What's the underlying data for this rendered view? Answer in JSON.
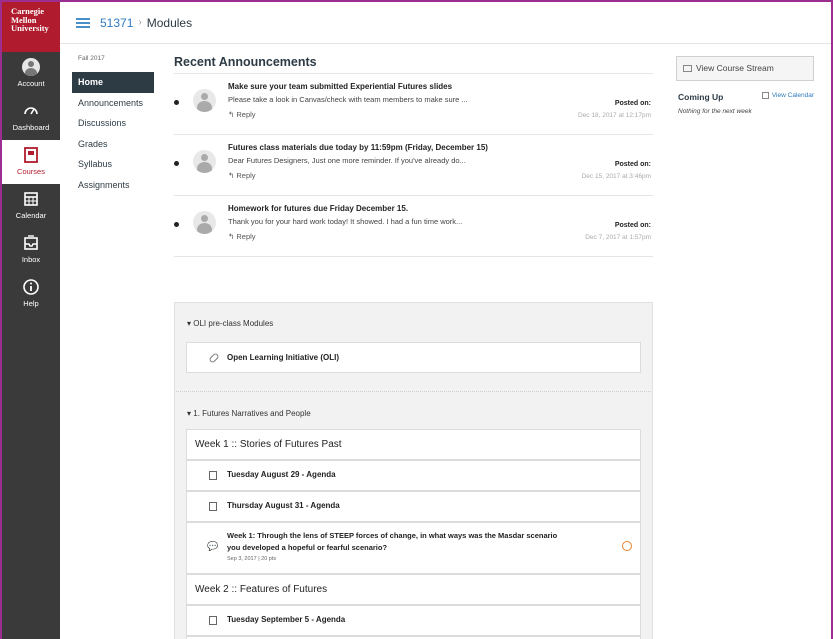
{
  "brand": {
    "logo_lines": [
      "Carnegie",
      "Mellon",
      "University"
    ],
    "accent": "#b01c2e",
    "nav_bg": "#3a3a3a"
  },
  "global_nav": [
    {
      "label": "Account",
      "icon": "account-icon"
    },
    {
      "label": "Dashboard",
      "icon": "dashboard-icon"
    },
    {
      "label": "Courses",
      "icon": "courses-icon",
      "active": true
    },
    {
      "label": "Calendar",
      "icon": "calendar-icon"
    },
    {
      "label": "Inbox",
      "icon": "inbox-icon"
    },
    {
      "label": "Help",
      "icon": "help-icon"
    }
  ],
  "breadcrumb": {
    "course": "51371",
    "separator": "›",
    "current": "Modules"
  },
  "course_nav": {
    "term": "Fall 2017",
    "items": [
      "Home",
      "Announcements",
      "Discussions",
      "Grades",
      "Syllabus",
      "Assignments"
    ],
    "active_index": 0
  },
  "announcements": {
    "heading": "Recent Announcements",
    "items": [
      {
        "title": "Make sure your team submitted Experiential Futures slides",
        "message": "Please take a look in Canvas/check with team members to make sure ...",
        "reply": "Reply",
        "posted_label": "Posted on:",
        "date": "Dec 18, 2017 at 12:17pm"
      },
      {
        "title": "Futures class materials due today by 11:59pm (Friday, December 15)",
        "message": "Dear Futures Designers, Just one more reminder. If you've already do...",
        "reply": "Reply",
        "posted_label": "Posted on:",
        "date": "Dec 15, 2017 at 3:46pm"
      },
      {
        "title": "Homework for futures due Friday December 15.",
        "message": "Thank you for your hard work today! It showed. I had a fun time work...",
        "reply": "Reply",
        "posted_label": "Posted on:",
        "date": "Dec 7, 2017 at 1:57pm"
      }
    ]
  },
  "modules": {
    "module1": {
      "header": "OLI pre-class Modules",
      "item": "Open Learning Initiative (OLI)"
    },
    "module2": {
      "header": "1. Futures Narratives and People",
      "week1": "Week 1 :: Stories of Futures Past",
      "item1": "Tuesday August 29 - Agenda",
      "item2": "Thursday August 31 - Agenda",
      "discussion_line1": "Week 1: Through the lens of STEEP forces of change, in what ways was the Masdar scenario",
      "discussion_line2": "you developed a hopeful or fearful scenario?",
      "discussion_meta": "Sep 3, 2017 | 20 pts",
      "week2": "Week 2 :: Features of Futures",
      "item3": "Tuesday September 5 - Agenda"
    }
  },
  "sidebar": {
    "stream_button": "View Course Stream",
    "coming_up": "Coming Up",
    "view_calendar": "View Calendar",
    "nothing": "Nothing for the next week"
  }
}
